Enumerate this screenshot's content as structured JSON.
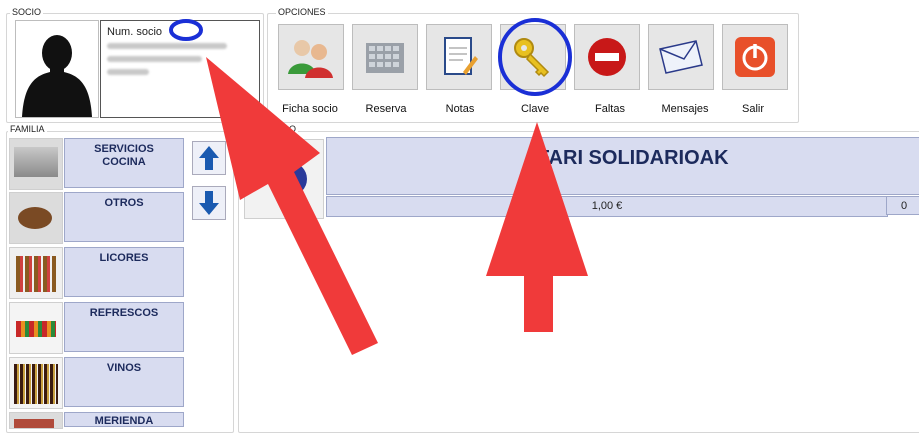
{
  "socio": {
    "title": "SOCIO",
    "num_label": "Num. socio"
  },
  "opciones": {
    "title": "OPCIONES",
    "buttons": [
      {
        "label": "Ficha socio",
        "icon": "users-icon"
      },
      {
        "label": "Reserva",
        "icon": "calendar-grid-icon"
      },
      {
        "label": "Notas",
        "icon": "notepad-icon"
      },
      {
        "label": "Clave",
        "icon": "key-icon"
      },
      {
        "label": "Faltas",
        "icon": "no-entry-icon"
      },
      {
        "label": "Mensajes",
        "icon": "envelope-icon"
      },
      {
        "label": "Salir",
        "icon": "power-icon"
      }
    ]
  },
  "familia": {
    "title": "FAMILIA",
    "items": [
      {
        "label": "SERVICIOS COCINA",
        "thumb": "kitchen-photo"
      },
      {
        "label": "OTROS",
        "thumb": "coffee-photo"
      },
      {
        "label": "LICORES",
        "thumb": "liquor-bottles-photo"
      },
      {
        "label": "REFRESCOS",
        "thumb": "soft-drinks-photo"
      },
      {
        "label": "VINOS",
        "thumb": "wine-bottles-photo"
      },
      {
        "label": "MERIENDA",
        "thumb": "snack-photo"
      }
    ]
  },
  "articulo": {
    "title_partial": "LO",
    "name": "AFARI SOLIDARIOAK",
    "price": "1,00 €",
    "price_partial": "0"
  },
  "colors": {
    "annotation_arrow": "#f03a3a",
    "annotation_circle": "#1a2fd6",
    "button_blue": "#d8dcf0"
  }
}
